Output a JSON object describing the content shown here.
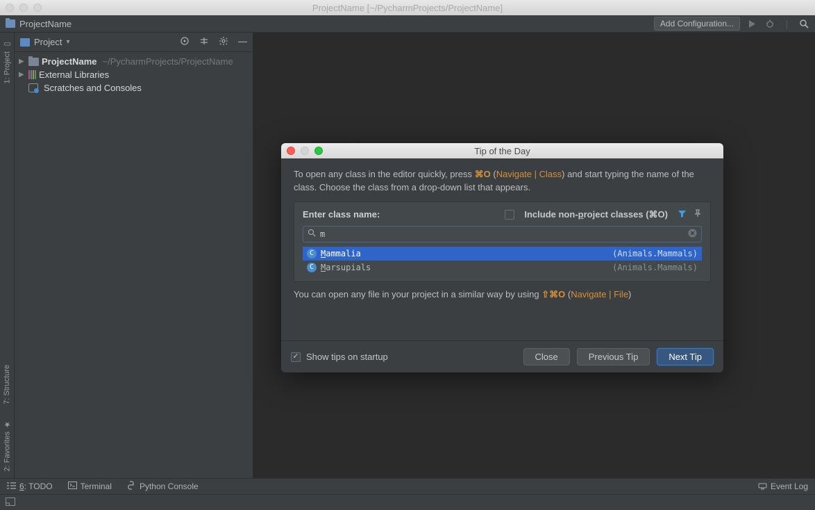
{
  "window": {
    "title": "ProjectName [~/PycharmProjects/ProjectName]"
  },
  "navbar": {
    "breadcrumb": "ProjectName",
    "add_config": "Add Configuration..."
  },
  "left_gutter": {
    "project": "1: Project",
    "structure": "7: Structure",
    "favorites": "2: Favorites"
  },
  "sidebar": {
    "header": "Project",
    "tree": {
      "root_name": "ProjectName",
      "root_path": "~/PycharmProjects/ProjectName",
      "ext_lib": "External Libraries",
      "scratches": "Scratches and Consoles"
    }
  },
  "dialog": {
    "title": "Tip of the Day",
    "tip1_a": "To open any class in the editor quickly, press ",
    "tip1_key": "⌘O",
    "tip1_b": " (",
    "tip1_link": "Navigate | Class",
    "tip1_c": ") and start typing the name of the class. Choose the class from a drop-down list that appears.",
    "panel": {
      "label": "Enter class name:",
      "include_a": "Include non-",
      "include_u": "p",
      "include_b": "roject classes (⌘O)",
      "search_value": "m",
      "results": [
        {
          "name_u": "M",
          "name_rest": "ammalia",
          "pkg": "(Animals.Mammals)",
          "selected": true
        },
        {
          "name_u": "M",
          "name_rest": "arsupials",
          "pkg": "(Animals.Mammals)",
          "selected": false
        }
      ]
    },
    "tip2_a": "You can open any file in your project in a similar way by using ",
    "tip2_key": "⇧⌘O",
    "tip2_b": " (",
    "tip2_link": "Navigate | File",
    "tip2_c": ")",
    "show_tips": "Show tips on startup",
    "close": "Close",
    "prev": "Previous Tip",
    "next": "Next Tip"
  },
  "bottom": {
    "todo_num": "6",
    "todo": ": TODO",
    "terminal": "Terminal",
    "python_console": "Python Console",
    "event_log": "Event Log"
  }
}
